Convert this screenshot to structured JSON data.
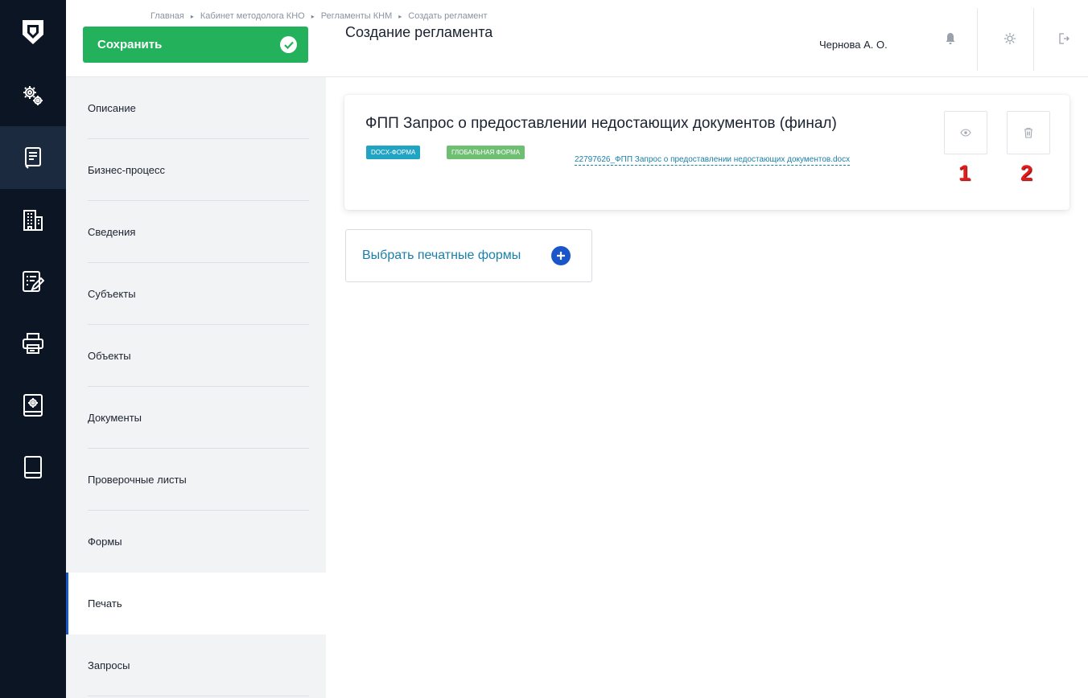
{
  "breadcrumb": [
    "Главная",
    "Кабинет методолога КНО",
    "Регламенты КНМ",
    "Создать регламент"
  ],
  "breadcrumb_separator": "▸",
  "toolbar": {
    "save_label": "Сохранить"
  },
  "page_title": "Создание регламента",
  "user": {
    "name": "Чернова А. О."
  },
  "rail_icons": [
    "logo-shield-icon",
    "settings-gears-icon",
    "document-list-icon",
    "building-icon",
    "edit-form-icon",
    "printer-icon",
    "settings-book-icon",
    "book-icon"
  ],
  "top_icons": [
    "bell-icon",
    "gear-icon",
    "logout-icon"
  ],
  "sidebar": {
    "items": [
      {
        "label": "Описание"
      },
      {
        "label": "Бизнес-процесс"
      },
      {
        "label": "Сведения"
      },
      {
        "label": "Субъекты"
      },
      {
        "label": "Объекты"
      },
      {
        "label": "Документы"
      },
      {
        "label": "Проверочные листы"
      },
      {
        "label": "Формы"
      },
      {
        "label": "Печать",
        "active": true
      },
      {
        "label": "Запросы"
      }
    ]
  },
  "print_form": {
    "title": "ФПП Запрос о предоставлении недостающих документов (финал)",
    "tags": [
      "DOCX-ФОРМА",
      "ГЛОБАЛЬНАЯ ФОРМА"
    ],
    "file_name": "22797626_ФПП Запрос о предоставлении недостающих документов.docx",
    "view_icon": "eye-icon",
    "delete_icon": "trash-icon",
    "annotations": [
      "1",
      "2"
    ]
  },
  "select_forms_label": "Выбрать печатные формы",
  "colors": {
    "rail_bg": "#0c1524",
    "save_green": "#23b15c",
    "accent_blue": "#1a56c9",
    "link_teal": "#1b7fa8",
    "tag_docx": "#21a3c4",
    "tag_global": "#6fbf72",
    "annotation_red": "#e31b1b"
  }
}
